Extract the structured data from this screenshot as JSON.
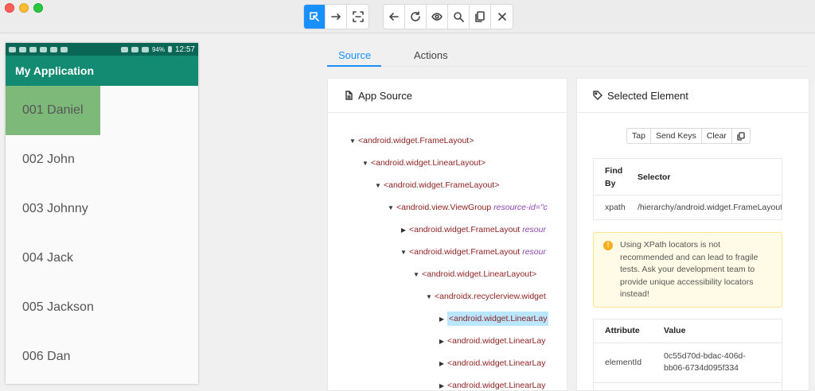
{
  "toolbar": {
    "mode_buttons": [
      {
        "icon": "select-element-icon",
        "active": true
      },
      {
        "icon": "swipe-icon",
        "active": false
      },
      {
        "icon": "tap-by-coordinates-icon",
        "active": false
      }
    ],
    "action_buttons": [
      {
        "icon": "back-icon"
      },
      {
        "icon": "refresh-icon"
      },
      {
        "icon": "eye-icon"
      },
      {
        "icon": "search-icon"
      },
      {
        "icon": "copy-icon"
      },
      {
        "icon": "close-icon"
      }
    ]
  },
  "device": {
    "status_bar": {
      "battery": "94%",
      "time": "12:57"
    },
    "app_title": "My Application",
    "items": [
      "001 Daniel",
      "002 John",
      "003 Johnny",
      "004 Jack",
      "005 Jackson",
      "006 Dan"
    ]
  },
  "tabs": {
    "source": "Source",
    "actions": "Actions"
  },
  "app_source": {
    "title": "App Source",
    "nodes": [
      {
        "label": "<android.widget.FrameLayout>",
        "attr": "",
        "toggle": "▼"
      },
      {
        "label": "<android.widget.LinearLayout>",
        "attr": "",
        "toggle": "▼"
      },
      {
        "label": "<android.widget.FrameLayout>",
        "attr": "",
        "toggle": "▼"
      },
      {
        "label": "<android.view.ViewGroup",
        "attr": "resource-id=\"c",
        "toggle": "▼"
      },
      {
        "label": "<android.widget.FrameLayout",
        "attr": "resour",
        "toggle": "▶"
      },
      {
        "label": "<android.widget.FrameLayout",
        "attr": "resour",
        "toggle": "▼"
      },
      {
        "label": "<android.widget.LinearLayout>",
        "attr": "",
        "toggle": "▼"
      },
      {
        "label": "<androidx.recyclerview.widget",
        "attr": "",
        "toggle": "▼"
      },
      {
        "label": "<android.widget.LinearLay",
        "attr": "",
        "toggle": "▶"
      },
      {
        "label": "<android.widget.LinearLay",
        "attr": "",
        "toggle": "▶"
      },
      {
        "label": "<android.widget.LinearLay",
        "attr": "",
        "toggle": "▶"
      },
      {
        "label": "<android.widget.LinearLay",
        "attr": "",
        "toggle": "▶"
      }
    ]
  },
  "selected_element": {
    "title": "Selected Element",
    "buttons": {
      "tap": "Tap",
      "send_keys": "Send Keys",
      "clear": "Clear"
    },
    "selector_table": {
      "headers": {
        "find_by_1": "Find",
        "find_by_2": "By",
        "selector": "Selector"
      },
      "row": {
        "find_by": "xpath",
        "selector": "/hierarchy/android.widget.FrameLayout/and"
      }
    },
    "warning": "Using XPath locators is not recommended and can lead to fragile tests. Ask your development team to provide unique accessibility locators instead!",
    "attributes": {
      "headers": {
        "attribute": "Attribute",
        "value": "Value"
      },
      "rows": [
        {
          "attribute": "elementId",
          "value_1": "0c55d70d-bdac-406d-",
          "value_2": "bb06-6734d095f334"
        }
      ]
    }
  }
}
